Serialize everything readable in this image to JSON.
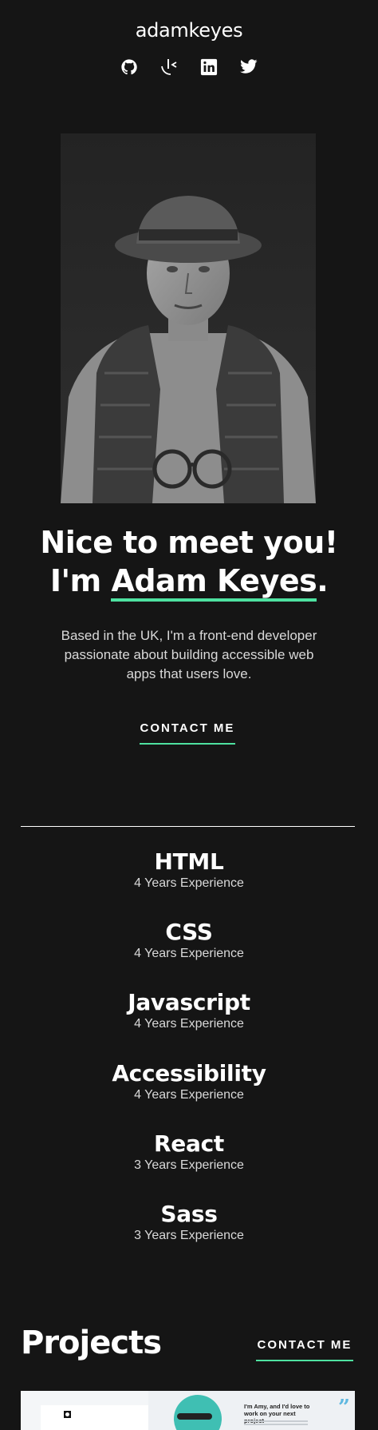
{
  "header": {
    "brand": "adamkeyes",
    "socials": [
      {
        "icon": "github-icon"
      },
      {
        "icon": "frontend-mentor-icon"
      },
      {
        "icon": "linkedin-icon"
      },
      {
        "icon": "twitter-icon"
      }
    ]
  },
  "hero": {
    "headline_line1": "Nice to meet you!",
    "headline_prefix": "I'm ",
    "headline_name": "Adam Keyes",
    "headline_suffix": ".",
    "intro": "Based in the UK, I'm a front-end developer passionate about building accessible web apps that users love.",
    "contact_label": "CONTACT ME"
  },
  "skills": [
    {
      "name": "HTML",
      "experience": "4 Years Experience"
    },
    {
      "name": "CSS",
      "experience": "4 Years Experience"
    },
    {
      "name": "Javascript",
      "experience": "4 Years Experience"
    },
    {
      "name": "Accessibility",
      "experience": "4 Years Experience"
    },
    {
      "name": "React",
      "experience": "3 Years Experience"
    },
    {
      "name": "Sass",
      "experience": "3 Years Experience"
    }
  ],
  "projects": {
    "title": "Projects",
    "contact_label": "CONTACT ME",
    "thumb_text": "I'm Amy, and I'd love to work on your next project"
  },
  "colors": {
    "background": "#151515",
    "accent": "#4ee1a0",
    "text": "#ffffff",
    "muted": "#d9d9d9"
  }
}
